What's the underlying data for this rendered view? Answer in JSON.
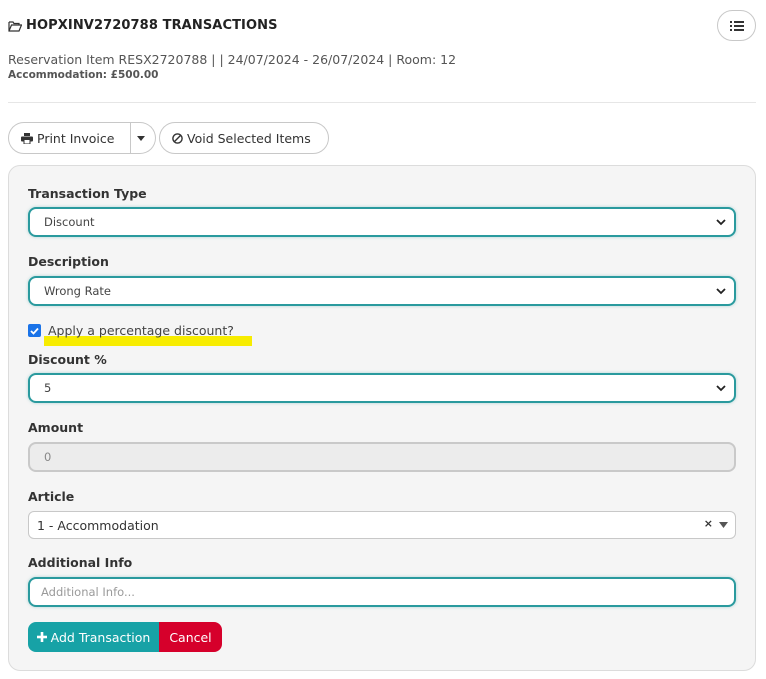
{
  "header": {
    "title": "HOPXINV2720788 TRANSACTIONS",
    "subtitle": "Reservation Item RESX2720788 | | 24/07/2024 - 26/07/2024 | Room: 12",
    "accommodation": "Accommodation: £500.00"
  },
  "toolbar": {
    "print_label": "Print Invoice",
    "void_label": "Void Selected Items"
  },
  "form": {
    "transaction_type_label": "Transaction Type",
    "transaction_type_value": "Discount",
    "description_label": "Description",
    "description_value": "Wrong Rate",
    "percentage_checkbox_label": "Apply a percentage discount?",
    "percentage_checked": true,
    "discount_label": "Discount %",
    "discount_value": "5",
    "amount_label": "Amount",
    "amount_value": "0",
    "article_label": "Article",
    "article_value": "1 - Accommodation",
    "article_clear": "×",
    "additional_info_label": "Additional Info",
    "additional_info_placeholder": "Additional Info..."
  },
  "actions": {
    "add_label": "Add Transaction",
    "cancel_label": "Cancel"
  },
  "colors": {
    "accent_teal": "#17a2a6",
    "cancel_red": "#d6002b",
    "highlight": "#f7ec00",
    "checkbox": "#1a73e8"
  }
}
